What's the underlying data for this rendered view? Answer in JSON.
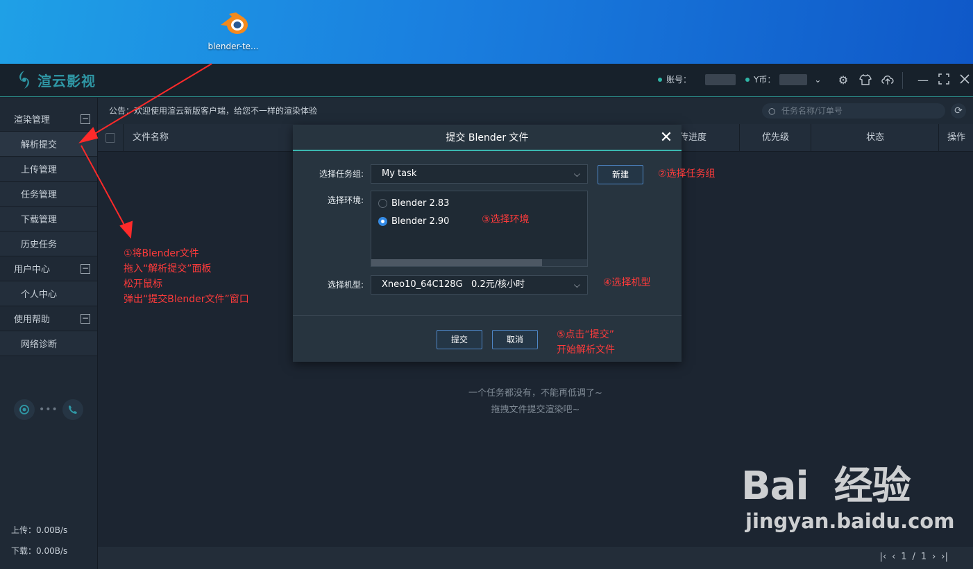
{
  "desktop": {
    "icon_label": "blender-te..."
  },
  "app": {
    "brand": "渲云影视",
    "account_label": "账号：",
    "coin_label": "Y币：",
    "notice": "公告：欢迎使用渲云新版客户端，给您不一样的渲染体验",
    "search_placeholder": "任务名称/订单号"
  },
  "sidebar": {
    "groups": [
      {
        "label": "渲染管理",
        "items": [
          "解析提交",
          "上传管理",
          "任务管理",
          "下载管理",
          "历史任务"
        ]
      },
      {
        "label": "用户中心",
        "items": [
          "个人中心"
        ]
      },
      {
        "label": "使用帮助",
        "items": [
          "网络诊断"
        ]
      }
    ],
    "upload_speed": "上传：0.00B/s",
    "download_speed": "下载：0.00B/s"
  },
  "table": {
    "columns": [
      "文件名称",
      "传进度",
      "优先级",
      "状态",
      "操作"
    ],
    "empty_line1": "一个任务都没有，不能再低调了~",
    "empty_line2": "拖拽文件提交渲染吧~"
  },
  "pager": {
    "current": "1",
    "sep": "/",
    "total": "1"
  },
  "dialog": {
    "title": "提交 Blender 文件",
    "task_group_label": "选择任务组:",
    "task_group_value": "My task",
    "new_button": "新建",
    "env_label": "选择环境:",
    "envs": [
      "Blender 2.83",
      "Blender 2.90"
    ],
    "env_selected": "Blender 2.90",
    "machine_label": "选择机型:",
    "machine_value": "Xneo10_64C128G   0.2元/核小时",
    "submit": "提交",
    "cancel": "取消"
  },
  "annotations": {
    "step1": [
      "①将Blender文件",
      "拖入“解析提交”面板",
      "松开鼠标",
      "弹出“提交Blender文件”窗口"
    ],
    "step2": "②选择任务组",
    "step3": "③选择环境",
    "step4": "④选择机型",
    "step5": [
      "⑤点击“提交”",
      "开始解析文件"
    ]
  },
  "watermark": {
    "top": "Bai  经验",
    "bottom": "jingyan.baidu.com"
  },
  "colors": {
    "accent": "#3bb8b0",
    "annotation": "#ff3b3b",
    "brand": "#2f97a5"
  }
}
